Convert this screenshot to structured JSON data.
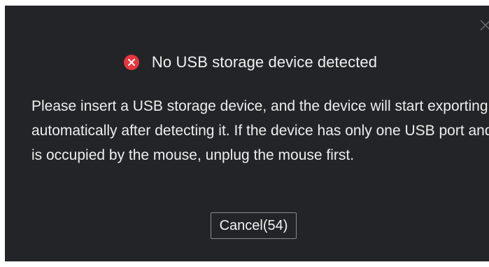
{
  "dialog": {
    "title": "No USB storage device detected",
    "title_icon": "error-circle-icon",
    "message": "Please insert a USB storage device, and the device will start exporting automatically after detecting it. If the device has only one USB port and is occupied by the mouse, unplug the mouse first.",
    "cancel_label": "Cancel(54)",
    "close_icon": "close-icon"
  },
  "colors": {
    "background": "#232427",
    "text": "#eeeeee",
    "error": "#e8363d",
    "button_border": "#8a8b8f"
  }
}
